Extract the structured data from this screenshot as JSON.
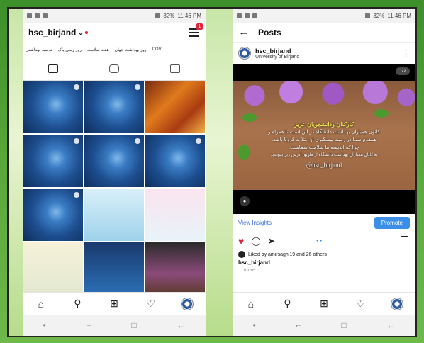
{
  "left": {
    "status": {
      "time": "11:46 PM",
      "battery": "32%"
    },
    "header": {
      "username": "hsc_birjand",
      "chevron": "⌄",
      "notif_count": "1"
    },
    "highlights": [
      "COVI",
      "روز بهداشت جهان",
      "هفته سلامت",
      "روز زمین پاک",
      "توصیه بهداشتی"
    ],
    "tabs": [
      "grid-icon",
      "igtv-icon",
      "tagged-icon"
    ],
    "grid": [
      "virus",
      "virus",
      "tri",
      "virus",
      "virus",
      "virus",
      "virus",
      "info1",
      "info2",
      "info3",
      "info4",
      "info5"
    ],
    "navbar": [
      "home-icon",
      "search-icon",
      "add-icon",
      "heart-icon",
      "profile-avatar"
    ]
  },
  "right": {
    "status": {
      "time": "11:46 PM",
      "battery": "32%"
    },
    "header": {
      "title": "Posts"
    },
    "post": {
      "username": "hsc_birjand",
      "location": "University of Birjand",
      "counter": "1/2",
      "text_heading": "کارکنان ودانشجویان عزیز",
      "text_lines": [
        "کانون همیاران بهداشت دانشگاه در این است تا همراه و",
        "همقدم شما در زمینه پیشگیری از ابتلا به کرونا باشد.",
        "چرا که اندیشه ما سلامت شماست.",
        "به کانال همیاران بهداشت دانشگاه از طریق آدرس زیر بپیوندید"
      ],
      "handle": "@hsc_birjand",
      "view_insights": "View Insights",
      "promote": "Promote",
      "liked_by": "Liked by amirsaghi19 and 26 others",
      "caption_user": "hsc_birjand",
      "more": "... more"
    }
  }
}
